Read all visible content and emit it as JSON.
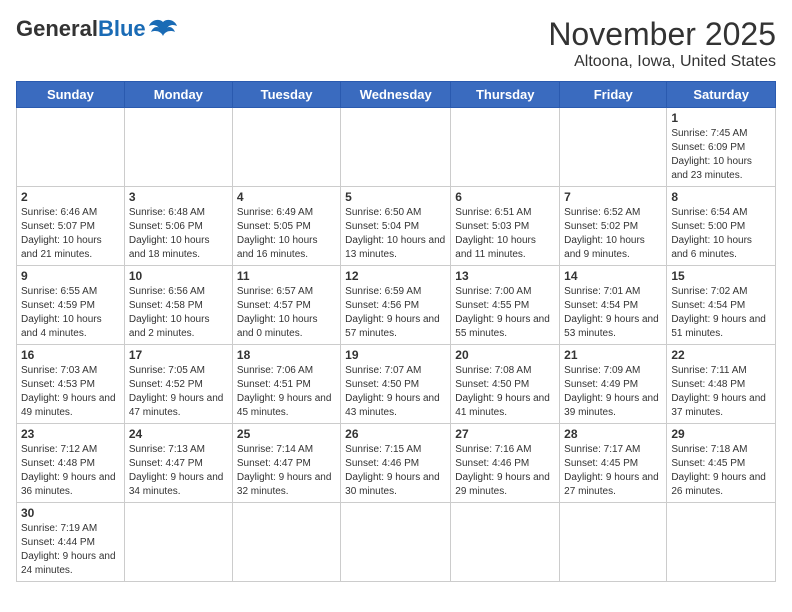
{
  "header": {
    "logo_general": "General",
    "logo_blue": "Blue",
    "month": "November 2025",
    "location": "Altoona, Iowa, United States"
  },
  "days_of_week": [
    "Sunday",
    "Monday",
    "Tuesday",
    "Wednesday",
    "Thursday",
    "Friday",
    "Saturday"
  ],
  "weeks": [
    [
      {
        "day": "",
        "info": ""
      },
      {
        "day": "",
        "info": ""
      },
      {
        "day": "",
        "info": ""
      },
      {
        "day": "",
        "info": ""
      },
      {
        "day": "",
        "info": ""
      },
      {
        "day": "",
        "info": ""
      },
      {
        "day": "1",
        "info": "Sunrise: 7:45 AM\nSunset: 6:09 PM\nDaylight: 10 hours and 23 minutes."
      }
    ],
    [
      {
        "day": "2",
        "info": "Sunrise: 6:46 AM\nSunset: 5:07 PM\nDaylight: 10 hours and 21 minutes."
      },
      {
        "day": "3",
        "info": "Sunrise: 6:48 AM\nSunset: 5:06 PM\nDaylight: 10 hours and 18 minutes."
      },
      {
        "day": "4",
        "info": "Sunrise: 6:49 AM\nSunset: 5:05 PM\nDaylight: 10 hours and 16 minutes."
      },
      {
        "day": "5",
        "info": "Sunrise: 6:50 AM\nSunset: 5:04 PM\nDaylight: 10 hours and 13 minutes."
      },
      {
        "day": "6",
        "info": "Sunrise: 6:51 AM\nSunset: 5:03 PM\nDaylight: 10 hours and 11 minutes."
      },
      {
        "day": "7",
        "info": "Sunrise: 6:52 AM\nSunset: 5:02 PM\nDaylight: 10 hours and 9 minutes."
      },
      {
        "day": "8",
        "info": "Sunrise: 6:54 AM\nSunset: 5:00 PM\nDaylight: 10 hours and 6 minutes."
      }
    ],
    [
      {
        "day": "9",
        "info": "Sunrise: 6:55 AM\nSunset: 4:59 PM\nDaylight: 10 hours and 4 minutes."
      },
      {
        "day": "10",
        "info": "Sunrise: 6:56 AM\nSunset: 4:58 PM\nDaylight: 10 hours and 2 minutes."
      },
      {
        "day": "11",
        "info": "Sunrise: 6:57 AM\nSunset: 4:57 PM\nDaylight: 10 hours and 0 minutes."
      },
      {
        "day": "12",
        "info": "Sunrise: 6:59 AM\nSunset: 4:56 PM\nDaylight: 9 hours and 57 minutes."
      },
      {
        "day": "13",
        "info": "Sunrise: 7:00 AM\nSunset: 4:55 PM\nDaylight: 9 hours and 55 minutes."
      },
      {
        "day": "14",
        "info": "Sunrise: 7:01 AM\nSunset: 4:54 PM\nDaylight: 9 hours and 53 minutes."
      },
      {
        "day": "15",
        "info": "Sunrise: 7:02 AM\nSunset: 4:54 PM\nDaylight: 9 hours and 51 minutes."
      }
    ],
    [
      {
        "day": "16",
        "info": "Sunrise: 7:03 AM\nSunset: 4:53 PM\nDaylight: 9 hours and 49 minutes."
      },
      {
        "day": "17",
        "info": "Sunrise: 7:05 AM\nSunset: 4:52 PM\nDaylight: 9 hours and 47 minutes."
      },
      {
        "day": "18",
        "info": "Sunrise: 7:06 AM\nSunset: 4:51 PM\nDaylight: 9 hours and 45 minutes."
      },
      {
        "day": "19",
        "info": "Sunrise: 7:07 AM\nSunset: 4:50 PM\nDaylight: 9 hours and 43 minutes."
      },
      {
        "day": "20",
        "info": "Sunrise: 7:08 AM\nSunset: 4:50 PM\nDaylight: 9 hours and 41 minutes."
      },
      {
        "day": "21",
        "info": "Sunrise: 7:09 AM\nSunset: 4:49 PM\nDaylight: 9 hours and 39 minutes."
      },
      {
        "day": "22",
        "info": "Sunrise: 7:11 AM\nSunset: 4:48 PM\nDaylight: 9 hours and 37 minutes."
      }
    ],
    [
      {
        "day": "23",
        "info": "Sunrise: 7:12 AM\nSunset: 4:48 PM\nDaylight: 9 hours and 36 minutes."
      },
      {
        "day": "24",
        "info": "Sunrise: 7:13 AM\nSunset: 4:47 PM\nDaylight: 9 hours and 34 minutes."
      },
      {
        "day": "25",
        "info": "Sunrise: 7:14 AM\nSunset: 4:47 PM\nDaylight: 9 hours and 32 minutes."
      },
      {
        "day": "26",
        "info": "Sunrise: 7:15 AM\nSunset: 4:46 PM\nDaylight: 9 hours and 30 minutes."
      },
      {
        "day": "27",
        "info": "Sunrise: 7:16 AM\nSunset: 4:46 PM\nDaylight: 9 hours and 29 minutes."
      },
      {
        "day": "28",
        "info": "Sunrise: 7:17 AM\nSunset: 4:45 PM\nDaylight: 9 hours and 27 minutes."
      },
      {
        "day": "29",
        "info": "Sunrise: 7:18 AM\nSunset: 4:45 PM\nDaylight: 9 hours and 26 minutes."
      }
    ],
    [
      {
        "day": "30",
        "info": "Sunrise: 7:19 AM\nSunset: 4:44 PM\nDaylight: 9 hours and 24 minutes."
      },
      {
        "day": "",
        "info": ""
      },
      {
        "day": "",
        "info": ""
      },
      {
        "day": "",
        "info": ""
      },
      {
        "day": "",
        "info": ""
      },
      {
        "day": "",
        "info": ""
      },
      {
        "day": "",
        "info": ""
      }
    ]
  ]
}
